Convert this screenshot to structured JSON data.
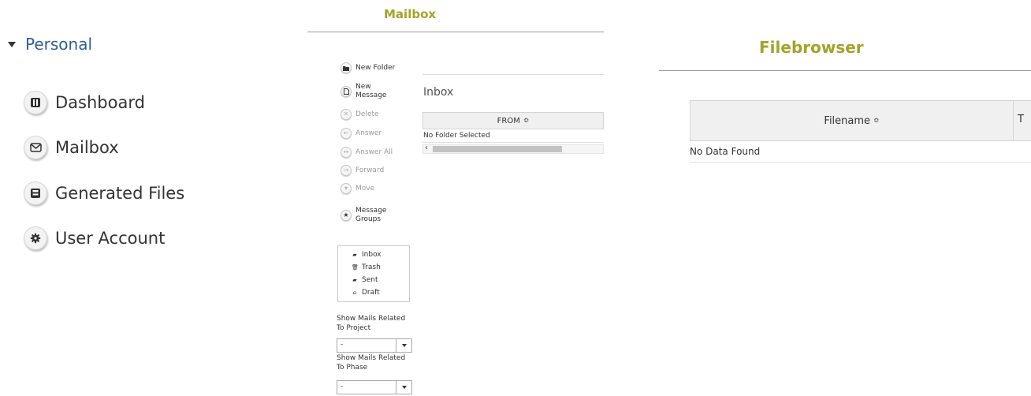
{
  "nav": {
    "section": "Personal",
    "items": [
      {
        "label": "Dashboard",
        "icon": "dashboard-icon"
      },
      {
        "label": "Mailbox",
        "icon": "envelope-icon"
      },
      {
        "label": "Generated Files",
        "icon": "floppy-disk-icon"
      },
      {
        "label": "User Account",
        "icon": "gear-icon"
      }
    ]
  },
  "mailbox": {
    "title": "Mailbox",
    "actions": {
      "new_folder": "New Folder",
      "new_message_line1": "New",
      "new_message_line2": "Message",
      "delete": "Delete",
      "answer": "Answer",
      "answer_all": "Answer All",
      "forward": "Forward",
      "move": "Move",
      "message_groups_line1": "Message",
      "message_groups_line2": "Groups"
    },
    "folders": [
      "Inbox",
      "Trash",
      "Sent",
      "Draft"
    ],
    "filter_project": {
      "line1": "Show Mails Related",
      "line2": "To Project",
      "value": "-"
    },
    "filter_phase": {
      "line1": "Show Mails Related",
      "line2": "To Phase",
      "value": "-"
    },
    "inbox_title": "Inbox",
    "column_from": "FROM",
    "sort_glyph": "≎",
    "empty_text": "No Folder Selected",
    "scroll_left": "‹"
  },
  "filebrowser": {
    "title": "Filebrowser",
    "column_filename": "Filename",
    "column_next": "T",
    "sort_glyph": "≎",
    "empty_text": "No Data Found"
  },
  "colors": {
    "title_accent": "#a3a32a",
    "section_link": "#2e5e9e"
  }
}
